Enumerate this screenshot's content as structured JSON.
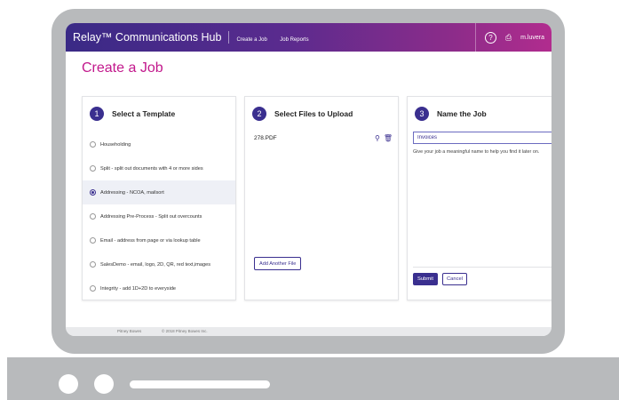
{
  "header": {
    "brand": "Relay™ Communications Hub",
    "nav": [
      "Create a Job",
      "Job Reports"
    ],
    "help_icon": "?",
    "tray_icon": "tray-icon",
    "user": "m.luvera"
  },
  "page": {
    "title": "Create a Job"
  },
  "step1": {
    "number": "1",
    "title": "Select a Template",
    "templates": [
      {
        "label": "Householding",
        "selected": false
      },
      {
        "label": "Split - split out documents with 4 or more sides",
        "selected": false
      },
      {
        "label": "Addressing - NCOA, mailsort",
        "selected": true
      },
      {
        "label": "Addressing Pre-Process - Split out overcounts",
        "selected": false
      },
      {
        "label": "Email - address from page or via lookup table",
        "selected": false
      },
      {
        "label": "SalesDemo - email, logo, 2D, QR, red text,images",
        "selected": false
      },
      {
        "label": "Integrity - add 1D+2D to everyside",
        "selected": false
      }
    ]
  },
  "step2": {
    "number": "2",
    "title": "Select Files to Upload",
    "file": "278.PDF",
    "add_button": "Add Another File"
  },
  "step3": {
    "number": "3",
    "title": "Name the Job",
    "job_name": "Invoices",
    "hint": "Give your job a meaningful name to help you find it later on.",
    "submit": "Submit",
    "cancel": "Cancel"
  },
  "footer": {
    "left": "Pitney Bowes",
    "copyright": "© 2018 Pitney Bowes Inc."
  },
  "colors": {
    "accent": "#3a2f8f",
    "title": "#c2188c",
    "frame": "#b8babc"
  }
}
